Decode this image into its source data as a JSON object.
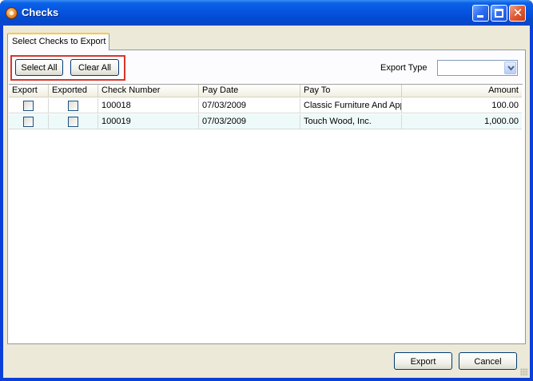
{
  "window": {
    "title": "Checks"
  },
  "tab": {
    "label": "Select Checks to Export"
  },
  "toolbar": {
    "select_all_label": "Select All",
    "clear_all_label": "Clear All",
    "export_type_label": "Export Type",
    "export_type_value": ""
  },
  "grid": {
    "columns": [
      "Export",
      "Exported",
      "Check Number",
      "Pay Date",
      "Pay To",
      "Amount"
    ],
    "rows": [
      {
        "export": false,
        "exported": false,
        "check_number": "100018",
        "pay_date": "07/03/2009",
        "pay_to": "Classic Furniture And Appliance",
        "amount": "100.00"
      },
      {
        "export": false,
        "exported": false,
        "check_number": "100019",
        "pay_date": "07/03/2009",
        "pay_to": "Touch Wood, Inc.",
        "amount": "1,000.00"
      }
    ]
  },
  "footer": {
    "export_label": "Export",
    "cancel_label": "Cancel"
  },
  "icons": {
    "app": "app-icon",
    "minimize": "minimize-icon",
    "maximize": "maximize-icon",
    "close": "close-icon",
    "dropdown": "chevron-down-icon",
    "resize": "resize-grip-icon"
  },
  "colors": {
    "title_bar": "#0554e0",
    "highlight_border": "#d9362b",
    "alt_row": "#eefaf9",
    "window_face": "#ece9d8"
  }
}
